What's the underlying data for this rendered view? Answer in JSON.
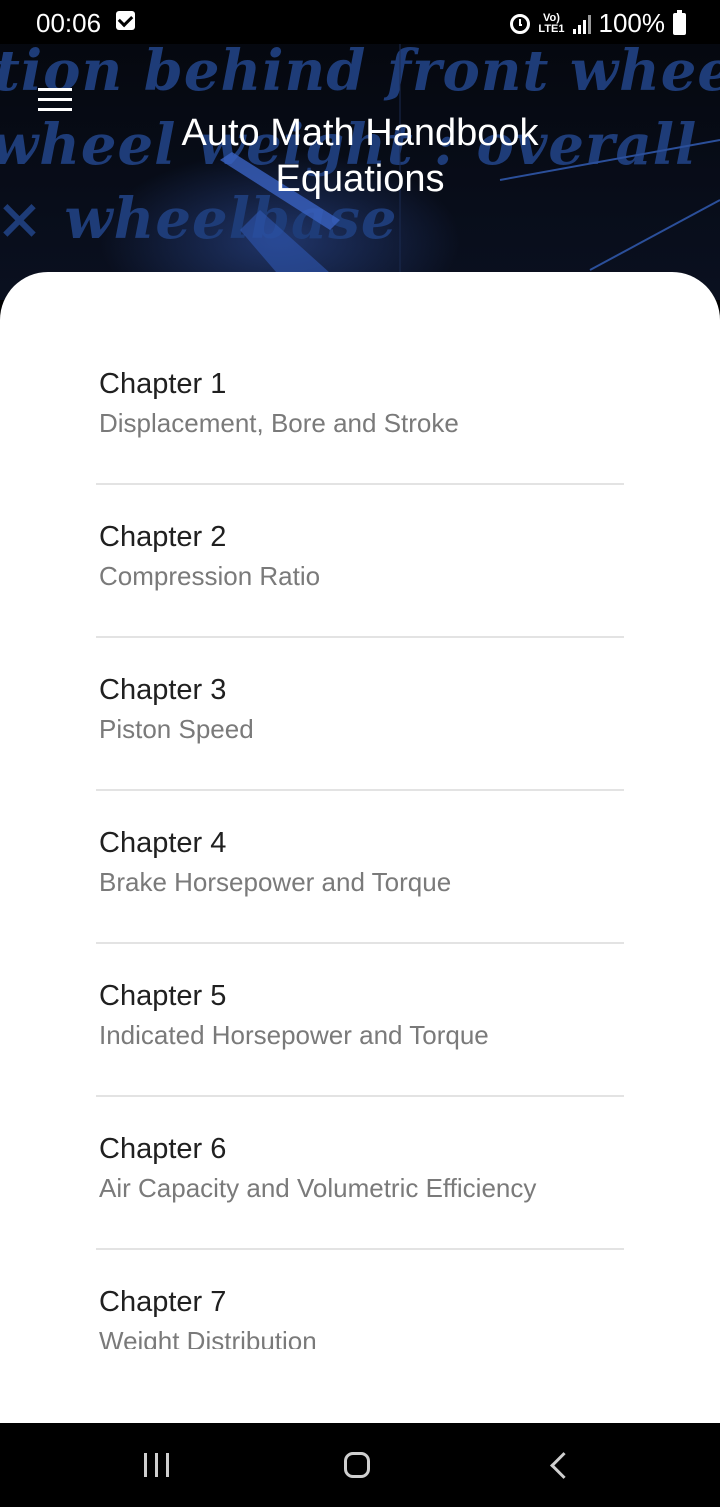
{
  "status_bar": {
    "time": "00:06",
    "network_label": "Vo) LTE1",
    "battery": "100%"
  },
  "header": {
    "title_line1": "Auto Math Handbook",
    "title_line2": "Equations"
  },
  "chapters": [
    {
      "title": "Chapter 1",
      "subtitle": "Displacement, Bore and Stroke"
    },
    {
      "title": "Chapter 2",
      "subtitle": "Compression Ratio"
    },
    {
      "title": "Chapter 3",
      "subtitle": "Piston Speed"
    },
    {
      "title": "Chapter 4",
      "subtitle": "Brake Horsepower and Torque"
    },
    {
      "title": "Chapter 5",
      "subtitle": "Indicated Horsepower and Torque"
    },
    {
      "title": "Chapter 6",
      "subtitle": "Air Capacity and Volumetric Efficiency"
    },
    {
      "title": "Chapter 7",
      "subtitle": "Weight Distribution"
    }
  ],
  "icons": {
    "menu": "hamburger-menu-icon",
    "alarm": "alarm-clock-icon",
    "signal": "cellular-signal-icon",
    "battery": "battery-full-icon",
    "nav_recent": "recent-apps-icon",
    "nav_home": "home-icon",
    "nav_back": "back-icon"
  },
  "colors": {
    "header_bg": "#0a1020",
    "accent_blue": "#1e3c78",
    "card_bg": "#ffffff",
    "subtitle_text": "#7a7a7a"
  }
}
